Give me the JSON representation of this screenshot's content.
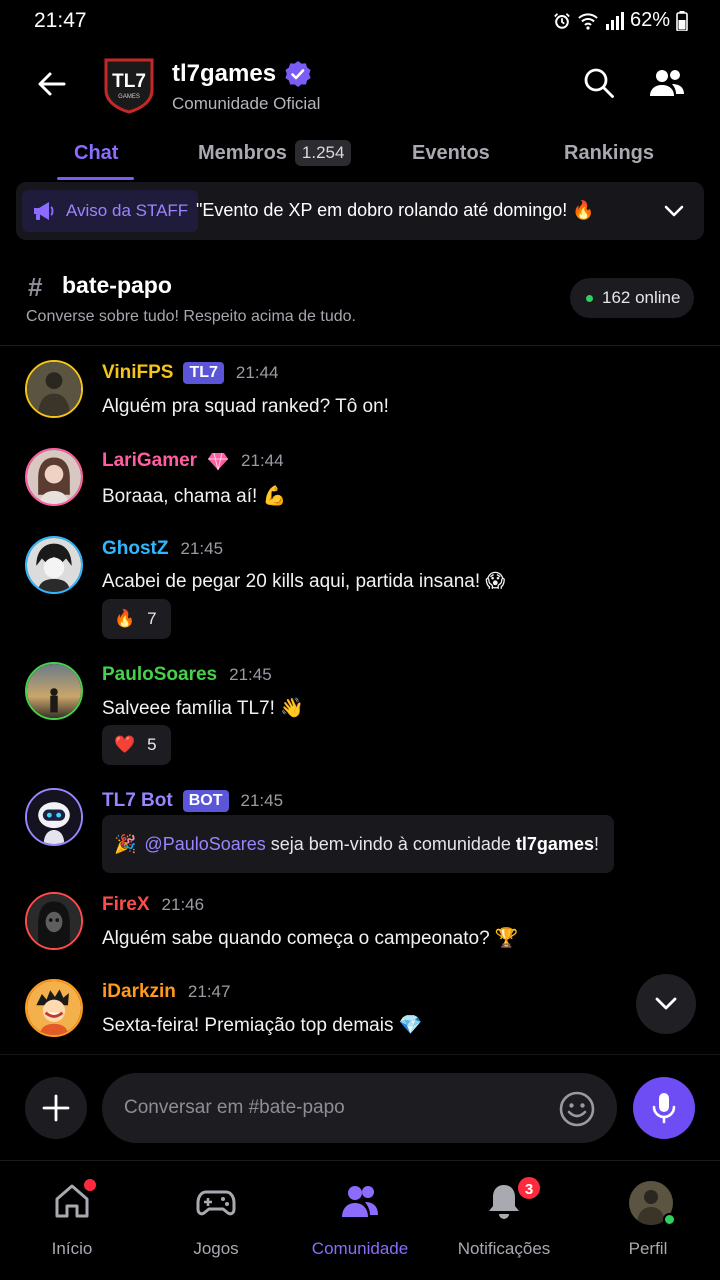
{
  "status": {
    "time": "21:47",
    "battery": "62%"
  },
  "header": {
    "title": "tl7games",
    "subtitle": "Comunidade Oficial",
    "logo_text": "TL7",
    "logo_sub": "GAMES"
  },
  "tabs": [
    {
      "label": "Chat",
      "active": true
    },
    {
      "label": "Membros",
      "count": "1.254"
    },
    {
      "label": "Eventos"
    },
    {
      "label": "Rankings"
    }
  ],
  "notice": {
    "tag": "Aviso da STAFF",
    "text": "\"Evento de XP em dobro rolando até domingo! 🔥"
  },
  "channel": {
    "name": "bate-papo",
    "description": "Converse sobre tudo! Respeito acima de tudo.",
    "online": "162 online"
  },
  "messages": [
    {
      "user": "ViniFPS",
      "color": "#f5c518",
      "tag": "TL7",
      "time": "21:44",
      "text": "Alguém pra squad ranked? Tô on!"
    },
    {
      "user": "LariGamer",
      "color": "#ff5fa2",
      "time": "21:44",
      "text": "Boraaa, chama aí! 💪"
    },
    {
      "user": "GhostZ",
      "color": "#2fb8ff",
      "time": "21:45",
      "text": "Acabei de pegar 20 kills aqui, partida insana! 😱",
      "reaction": {
        "emoji": "🔥",
        "count": "7"
      }
    },
    {
      "user": "PauloSoares",
      "color": "#45d14a",
      "time": "21:45",
      "text": "Salveee família TL7! 👋",
      "reaction": {
        "emoji": "❤️",
        "count": "5"
      }
    },
    {
      "user": "TL7 Bot",
      "color": "#9c84ff",
      "tag": "BOT",
      "time": "21:45",
      "bot": {
        "emoji": "🎉",
        "mention": "@PauloSoares",
        "text": " seja bem-vindo à comunidade ",
        "community": "tl7games",
        "end": "!"
      }
    },
    {
      "user": "FireX",
      "color": "#ff4b4b",
      "time": "21:46",
      "text": "Alguém sabe quando começa o campeonato? 🏆"
    },
    {
      "user": "iDarkzin",
      "color": "#ff9a1f",
      "time": "21:47",
      "text": "Sexta-feira! Premiação top demais 💎"
    }
  ],
  "composer": {
    "placeholder": "Conversar em #bate-papo"
  },
  "nav": [
    {
      "label": "Início"
    },
    {
      "label": "Jogos"
    },
    {
      "label": "Comunidade",
      "active": true
    },
    {
      "label": "Notificações",
      "badge": "3"
    },
    {
      "label": "Perfil"
    }
  ],
  "colors": {
    "accent": "#7b5cf5",
    "background": "#000000",
    "online": "#2fd05f",
    "badge": "#ff2a3d"
  }
}
